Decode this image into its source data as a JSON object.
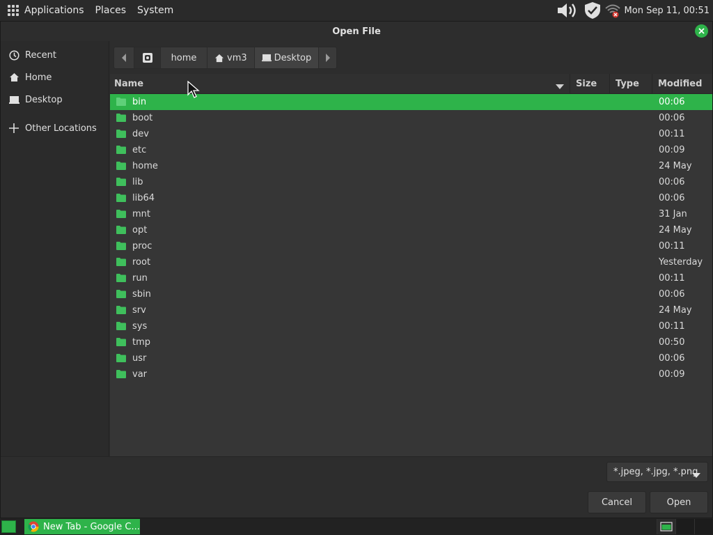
{
  "top_panel": {
    "menus": [
      "Applications",
      "Places",
      "System"
    ],
    "clock": "Mon Sep 11, 00:51",
    "tray_icons": [
      "volume-icon",
      "shield-icon",
      "wifi-disconnected-icon"
    ]
  },
  "dialog": {
    "title": "Open File",
    "sidebar": [
      {
        "label": "Recent",
        "icon": "clock-icon"
      },
      {
        "label": "Home",
        "icon": "home-icon"
      },
      {
        "label": "Desktop",
        "icon": "desktop-icon"
      },
      {
        "label": "Other Locations",
        "icon": "plus-icon"
      }
    ],
    "pathbar": {
      "items": [
        {
          "label": "home",
          "icon": ""
        },
        {
          "label": "vm3",
          "icon": "home-icon"
        },
        {
          "label": "Desktop",
          "icon": "desktop-icon"
        }
      ]
    },
    "columns": {
      "name": "Name",
      "size": "Size",
      "type": "Type",
      "modified": "Modified"
    },
    "files": [
      {
        "name": "bin",
        "modified": "00:06",
        "selected": true
      },
      {
        "name": "boot",
        "modified": "00:06"
      },
      {
        "name": "dev",
        "modified": "00:11"
      },
      {
        "name": "etc",
        "modified": "00:09"
      },
      {
        "name": "home",
        "modified": "24 May"
      },
      {
        "name": "lib",
        "modified": "00:06"
      },
      {
        "name": "lib64",
        "modified": "00:06"
      },
      {
        "name": "mnt",
        "modified": "31 Jan"
      },
      {
        "name": "opt",
        "modified": "24 May"
      },
      {
        "name": "proc",
        "modified": "00:11"
      },
      {
        "name": "root",
        "modified": "Yesterday"
      },
      {
        "name": "run",
        "modified": "00:11"
      },
      {
        "name": "sbin",
        "modified": "00:06"
      },
      {
        "name": "srv",
        "modified": "24 May"
      },
      {
        "name": "sys",
        "modified": "00:11"
      },
      {
        "name": "tmp",
        "modified": "00:50"
      },
      {
        "name": "usr",
        "modified": "00:06"
      },
      {
        "name": "var",
        "modified": "00:09"
      }
    ],
    "filter": "*.jpeg, *.jpg, *.png",
    "cancel_label": "Cancel",
    "open_label": "Open"
  },
  "taskbar": {
    "tasks": [
      {
        "label": "New Tab - Google C...",
        "icon": "chrome-icon"
      }
    ]
  },
  "colors": {
    "accent": "#2eb34a",
    "background": "#2d2d2d",
    "list_background": "#363636"
  }
}
